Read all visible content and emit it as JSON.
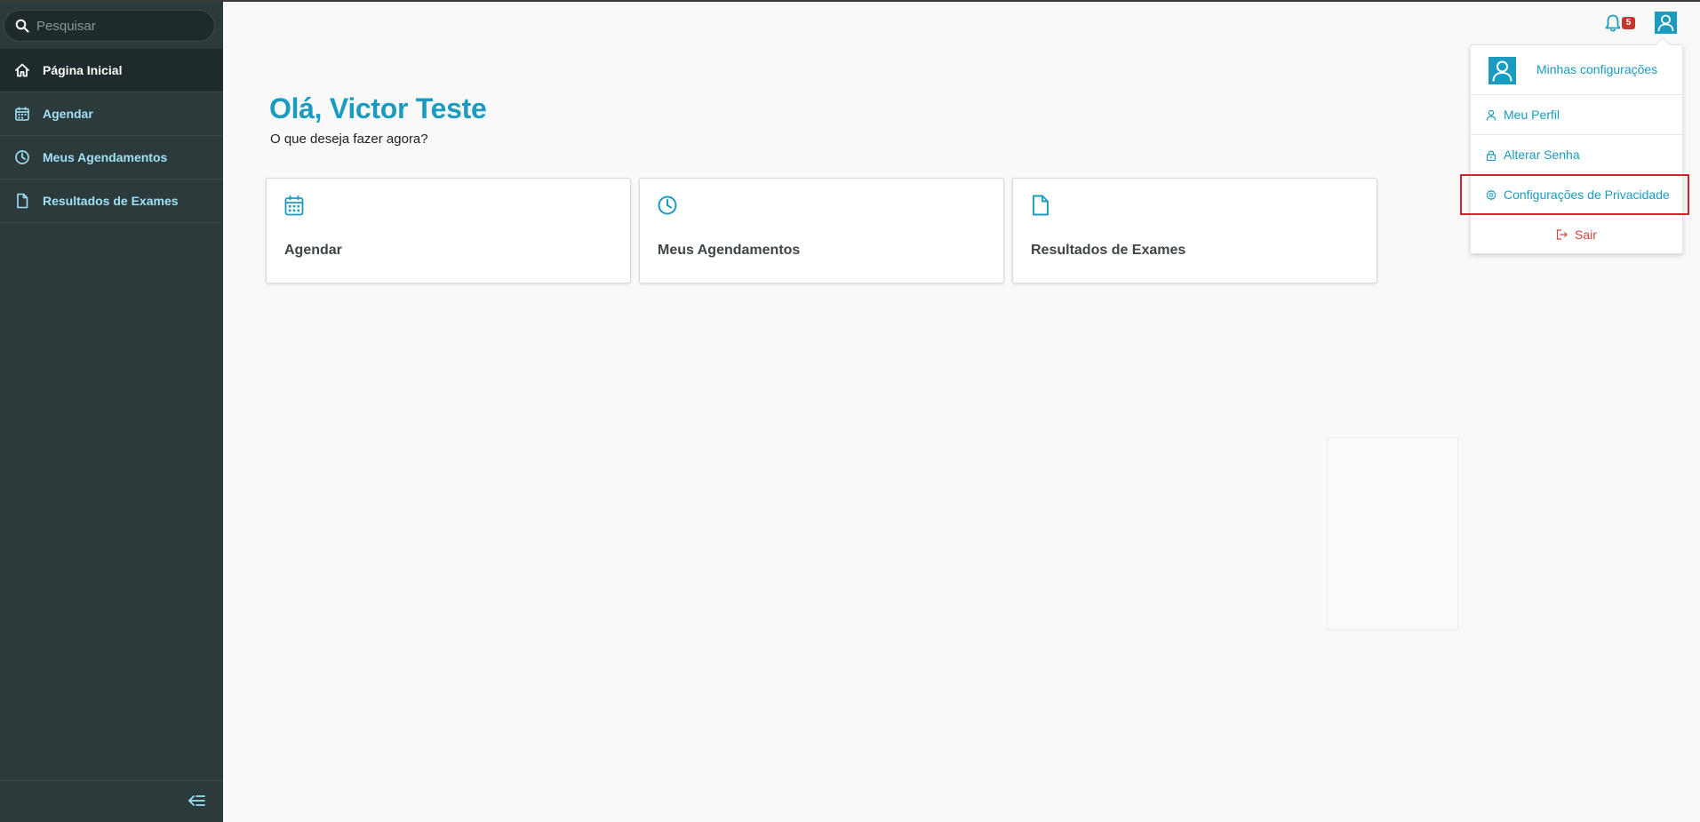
{
  "sidebar": {
    "search": {
      "placeholder": "Pesquisar"
    },
    "items": [
      {
        "label": "Página Inicial",
        "icon": "home-icon",
        "active": true
      },
      {
        "label": "Agendar",
        "icon": "calendar-icon",
        "active": false
      },
      {
        "label": "Meus Agendamentos",
        "icon": "clock-icon",
        "active": false
      },
      {
        "label": "Resultados de Exames",
        "icon": "document-icon",
        "active": false
      }
    ],
    "collapse_icon": "collapse-menu-icon"
  },
  "main": {
    "greeting": "Olá, Victor Teste",
    "subtitle": "O que deseja fazer agora?",
    "cards": [
      {
        "label": "Agendar",
        "icon": "calendar-icon"
      },
      {
        "label": "Meus Agendamentos",
        "icon": "clock-icon"
      },
      {
        "label": "Resultados de Exames",
        "icon": "document-icon"
      }
    ]
  },
  "header": {
    "notifications_count": "5",
    "notification_icon": "bell-icon",
    "user_icon": "user-icon"
  },
  "user_menu": {
    "title": "Minhas configurações",
    "items": [
      {
        "label": "Meu Perfil",
        "icon": "user-icon"
      },
      {
        "label": "Alterar Senha",
        "icon": "lock-icon"
      },
      {
        "label": "Configurações de Privacidade",
        "icon": "gear-icon",
        "highlighted": true
      }
    ],
    "logout": {
      "label": "Sair",
      "icon": "logout-icon"
    }
  },
  "colors": {
    "accent": "#1b9bc0",
    "sidebar_bg": "#2c3a3c",
    "sidebar_active_bg": "#1e2a2b",
    "nav_text": "#9fe0f5",
    "badge": "#c0392b",
    "logout": "#d0463b",
    "highlight_border": "#d3222a"
  }
}
